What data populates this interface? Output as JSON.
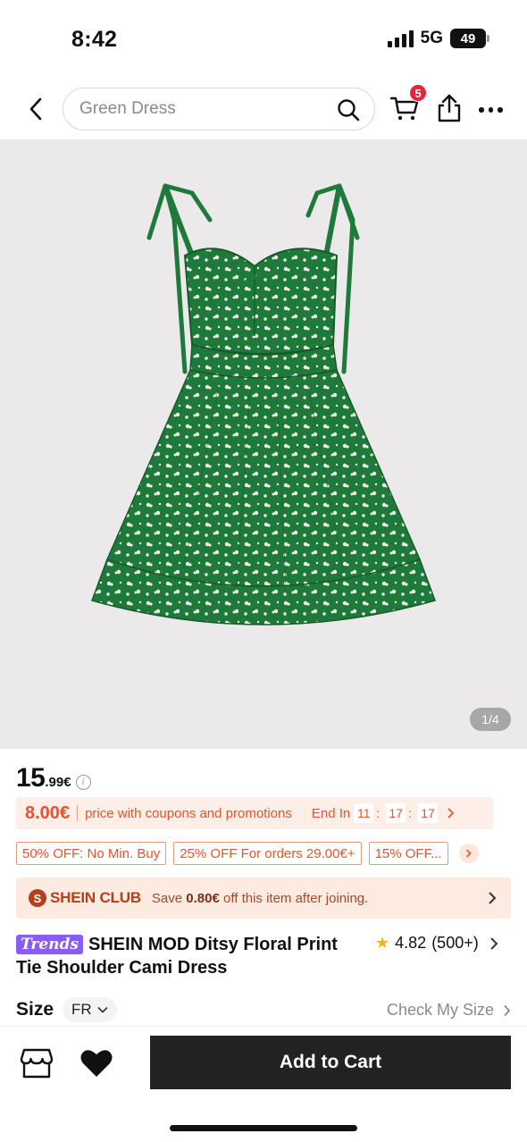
{
  "status_bar": {
    "time": "8:42",
    "network": "5G",
    "battery": "49"
  },
  "header": {
    "search_placeholder": "Green Dress",
    "cart_count": "5"
  },
  "gallery": {
    "counter": "1/4"
  },
  "price": {
    "integer": "15",
    "decimal": ".99€",
    "info_glyph": "i"
  },
  "coupon": {
    "price": "8.00€",
    "text": "price with coupons and promotions",
    "end_label": "End In",
    "timer": [
      "11",
      "17",
      "17"
    ]
  },
  "promotions": [
    "50% OFF: No Min. Buy",
    "25% OFF For orders 29.00€+",
    "15% OFF..."
  ],
  "club": {
    "name": "SHEIN CLUB",
    "text_prefix": "Save",
    "amount": "0.80€",
    "text_suffix": "off this item after joining."
  },
  "product": {
    "badge": "Trends",
    "title": "SHEIN MOD Ditsy Floral Print Tie Shoulder Cami Dress",
    "rating": "4.82",
    "review_count": "(500+)"
  },
  "size": {
    "label": "Size",
    "selected": "FR",
    "check_label": "Check My Size"
  },
  "bottom": {
    "add_to_cart": "Add to Cart"
  },
  "colors": {
    "accent": "#e5542c",
    "dress_green": "#1e7a3a",
    "badge_red": "#e7243b",
    "trends_purple": "#8a5cf6",
    "star": "#f7b500"
  },
  "icons": [
    "back-chevron-icon",
    "search-icon",
    "cart-icon",
    "share-icon",
    "more-icon",
    "info-icon",
    "chevron-right-icon",
    "club-logo-icon",
    "star-icon",
    "chevron-down-icon",
    "store-icon",
    "heart-icon"
  ]
}
